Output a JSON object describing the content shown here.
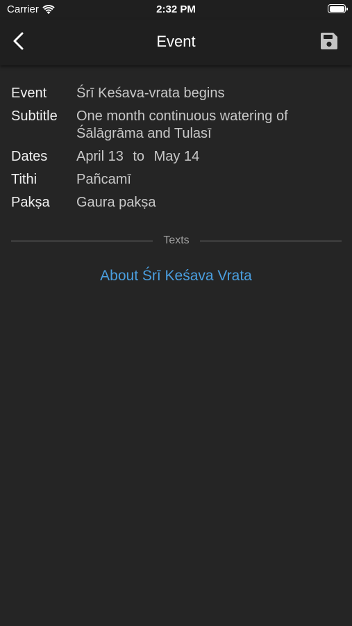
{
  "status_bar": {
    "carrier": "Carrier",
    "time": "2:32 PM",
    "wifi_icon": "wifi-icon",
    "battery_icon": "battery-icon"
  },
  "nav": {
    "back_icon": "chevron-left-icon",
    "title": "Event",
    "save_icon": "save-icon"
  },
  "event": {
    "event_label": "Event",
    "event_value": "Śrī Keśava-vrata begins",
    "subtitle_label": "Subtitle",
    "subtitle_value": "One month continuous watering of Śālāgrāma and Tulasī",
    "dates_label": "Dates",
    "dates_start": "April 13",
    "dates_separator": "to",
    "dates_end": "May 14",
    "tithi_label": "Tithi",
    "tithi_value": "Pañcamī",
    "paksa_label": "Pakṣa",
    "paksa_value": "Gaura pakṣa"
  },
  "texts": {
    "section_label": "Texts",
    "links": [
      "About Śrī Keśava Vrata"
    ]
  },
  "colors": {
    "background": "#252525",
    "bar_background": "#1f1f1f",
    "link": "#4a9fe0",
    "label": "#f0f0f0",
    "value": "#c8c8c8",
    "divider": "#7a7a7a"
  }
}
